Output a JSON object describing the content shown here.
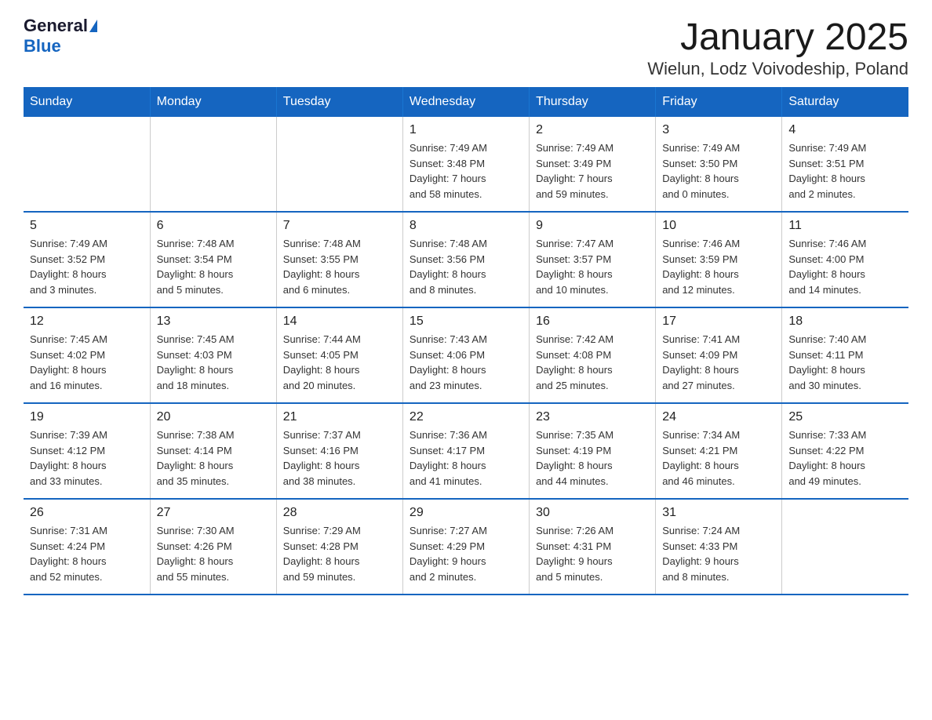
{
  "header": {
    "logo": {
      "general": "General",
      "blue": "Blue"
    },
    "title": "January 2025",
    "subtitle": "Wielun, Lodz Voivodeship, Poland"
  },
  "calendar": {
    "days_of_week": [
      "Sunday",
      "Monday",
      "Tuesday",
      "Wednesday",
      "Thursday",
      "Friday",
      "Saturday"
    ],
    "weeks": [
      [
        {
          "day": "",
          "info": ""
        },
        {
          "day": "",
          "info": ""
        },
        {
          "day": "",
          "info": ""
        },
        {
          "day": "1",
          "info": "Sunrise: 7:49 AM\nSunset: 3:48 PM\nDaylight: 7 hours\nand 58 minutes."
        },
        {
          "day": "2",
          "info": "Sunrise: 7:49 AM\nSunset: 3:49 PM\nDaylight: 7 hours\nand 59 minutes."
        },
        {
          "day": "3",
          "info": "Sunrise: 7:49 AM\nSunset: 3:50 PM\nDaylight: 8 hours\nand 0 minutes."
        },
        {
          "day": "4",
          "info": "Sunrise: 7:49 AM\nSunset: 3:51 PM\nDaylight: 8 hours\nand 2 minutes."
        }
      ],
      [
        {
          "day": "5",
          "info": "Sunrise: 7:49 AM\nSunset: 3:52 PM\nDaylight: 8 hours\nand 3 minutes."
        },
        {
          "day": "6",
          "info": "Sunrise: 7:48 AM\nSunset: 3:54 PM\nDaylight: 8 hours\nand 5 minutes."
        },
        {
          "day": "7",
          "info": "Sunrise: 7:48 AM\nSunset: 3:55 PM\nDaylight: 8 hours\nand 6 minutes."
        },
        {
          "day": "8",
          "info": "Sunrise: 7:48 AM\nSunset: 3:56 PM\nDaylight: 8 hours\nand 8 minutes."
        },
        {
          "day": "9",
          "info": "Sunrise: 7:47 AM\nSunset: 3:57 PM\nDaylight: 8 hours\nand 10 minutes."
        },
        {
          "day": "10",
          "info": "Sunrise: 7:46 AM\nSunset: 3:59 PM\nDaylight: 8 hours\nand 12 minutes."
        },
        {
          "day": "11",
          "info": "Sunrise: 7:46 AM\nSunset: 4:00 PM\nDaylight: 8 hours\nand 14 minutes."
        }
      ],
      [
        {
          "day": "12",
          "info": "Sunrise: 7:45 AM\nSunset: 4:02 PM\nDaylight: 8 hours\nand 16 minutes."
        },
        {
          "day": "13",
          "info": "Sunrise: 7:45 AM\nSunset: 4:03 PM\nDaylight: 8 hours\nand 18 minutes."
        },
        {
          "day": "14",
          "info": "Sunrise: 7:44 AM\nSunset: 4:05 PM\nDaylight: 8 hours\nand 20 minutes."
        },
        {
          "day": "15",
          "info": "Sunrise: 7:43 AM\nSunset: 4:06 PM\nDaylight: 8 hours\nand 23 minutes."
        },
        {
          "day": "16",
          "info": "Sunrise: 7:42 AM\nSunset: 4:08 PM\nDaylight: 8 hours\nand 25 minutes."
        },
        {
          "day": "17",
          "info": "Sunrise: 7:41 AM\nSunset: 4:09 PM\nDaylight: 8 hours\nand 27 minutes."
        },
        {
          "day": "18",
          "info": "Sunrise: 7:40 AM\nSunset: 4:11 PM\nDaylight: 8 hours\nand 30 minutes."
        }
      ],
      [
        {
          "day": "19",
          "info": "Sunrise: 7:39 AM\nSunset: 4:12 PM\nDaylight: 8 hours\nand 33 minutes."
        },
        {
          "day": "20",
          "info": "Sunrise: 7:38 AM\nSunset: 4:14 PM\nDaylight: 8 hours\nand 35 minutes."
        },
        {
          "day": "21",
          "info": "Sunrise: 7:37 AM\nSunset: 4:16 PM\nDaylight: 8 hours\nand 38 minutes."
        },
        {
          "day": "22",
          "info": "Sunrise: 7:36 AM\nSunset: 4:17 PM\nDaylight: 8 hours\nand 41 minutes."
        },
        {
          "day": "23",
          "info": "Sunrise: 7:35 AM\nSunset: 4:19 PM\nDaylight: 8 hours\nand 44 minutes."
        },
        {
          "day": "24",
          "info": "Sunrise: 7:34 AM\nSunset: 4:21 PM\nDaylight: 8 hours\nand 46 minutes."
        },
        {
          "day": "25",
          "info": "Sunrise: 7:33 AM\nSunset: 4:22 PM\nDaylight: 8 hours\nand 49 minutes."
        }
      ],
      [
        {
          "day": "26",
          "info": "Sunrise: 7:31 AM\nSunset: 4:24 PM\nDaylight: 8 hours\nand 52 minutes."
        },
        {
          "day": "27",
          "info": "Sunrise: 7:30 AM\nSunset: 4:26 PM\nDaylight: 8 hours\nand 55 minutes."
        },
        {
          "day": "28",
          "info": "Sunrise: 7:29 AM\nSunset: 4:28 PM\nDaylight: 8 hours\nand 59 minutes."
        },
        {
          "day": "29",
          "info": "Sunrise: 7:27 AM\nSunset: 4:29 PM\nDaylight: 9 hours\nand 2 minutes."
        },
        {
          "day": "30",
          "info": "Sunrise: 7:26 AM\nSunset: 4:31 PM\nDaylight: 9 hours\nand 5 minutes."
        },
        {
          "day": "31",
          "info": "Sunrise: 7:24 AM\nSunset: 4:33 PM\nDaylight: 9 hours\nand 8 minutes."
        },
        {
          "day": "",
          "info": ""
        }
      ]
    ]
  }
}
